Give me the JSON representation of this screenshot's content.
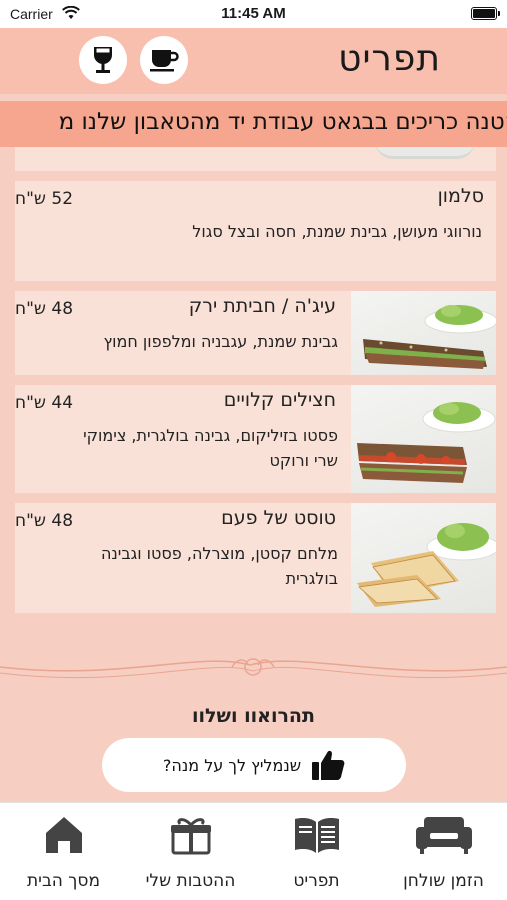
{
  "status_bar": {
    "carrier": "Carrier",
    "time": "11:45 AM"
  },
  "header": {
    "title": "תפריט",
    "wine_icon": "wine-glass-icon",
    "coffee_icon": "coffee-cup-icon"
  },
  "ticker": {
    "text": "קטנה כריכים בבגאט עבודת יד מהטאבון שלנו מ"
  },
  "menu": {
    "items": [
      {
        "name": "סלמון",
        "price": "52 ש\"ח",
        "description": "נורווגי מעושן, גבינת שמנת, חסה ובצל סגול"
      },
      {
        "name": "עיג'ה / חביתת ירק",
        "price": "48 ש\"ח",
        "description": "גבינת שמנת, עגבניה ומלפפון חמוץ"
      },
      {
        "name": "חצילים קלויים",
        "price": "44 ש\"ח",
        "description": "פסטו בזיליקום, גבינה בולגרית, צימוקי שרי ורוקט"
      },
      {
        "name": "טוסט של פעם",
        "price": "48 ש\"ח",
        "description": "מלחם קסטן, מוצרלה, פסטו וגבינה בולגרית"
      }
    ],
    "next_section_heading": "תהרואוו ושלוו"
  },
  "recommend_button": {
    "label": "שנמליץ לך על מנה?",
    "icon": "thumbs-up-icon"
  },
  "tabs": [
    {
      "label": "הזמן שולחן",
      "icon": "sofa-icon"
    },
    {
      "label": "תפריט",
      "icon": "menu-book-icon"
    },
    {
      "label": "ההטבות שלי",
      "icon": "gift-icon"
    },
    {
      "label": "מסך הבית",
      "icon": "home-icon"
    }
  ],
  "colors": {
    "background": "#f7cfc2",
    "header": "#f8bfae",
    "ticker": "#f6a68f",
    "card": "#fae1d8",
    "icon": "#444444"
  }
}
